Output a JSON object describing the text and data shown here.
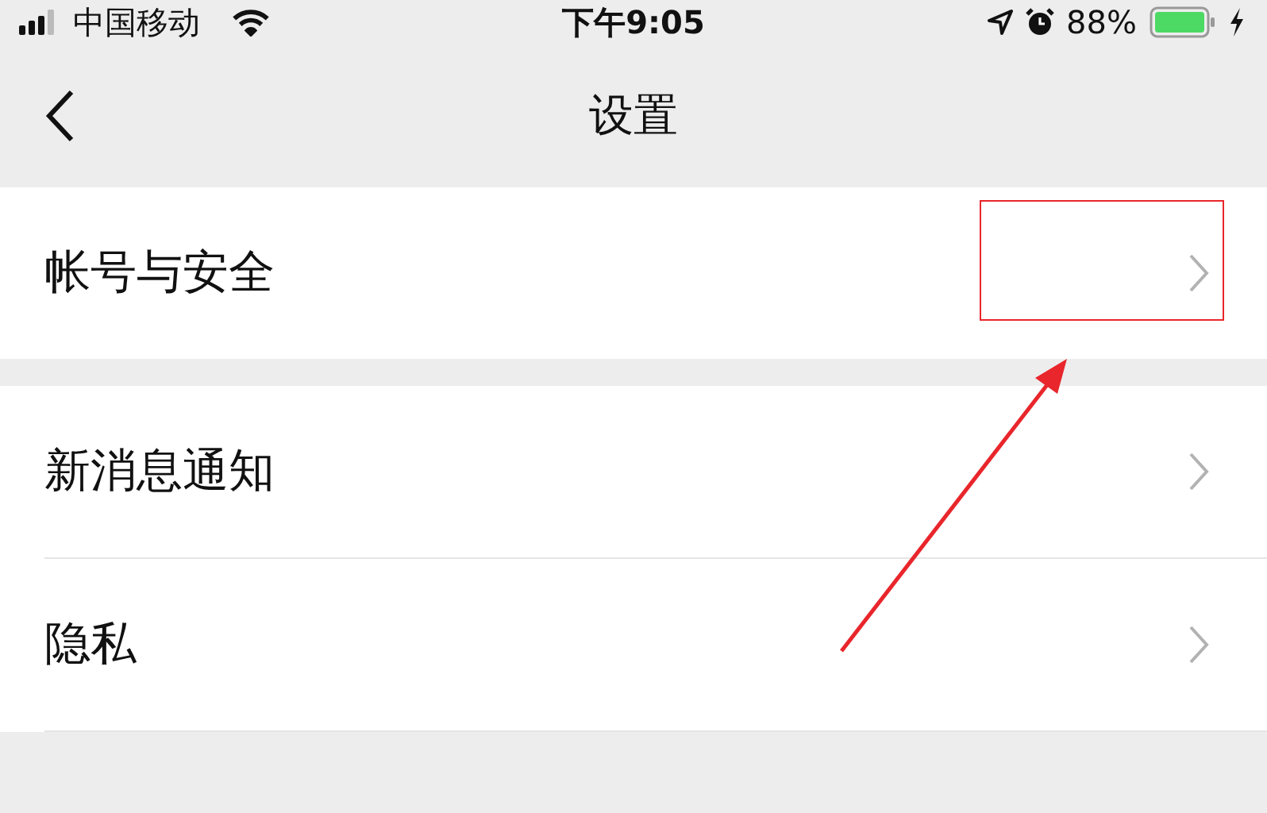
{
  "status_bar": {
    "carrier": "中国移动",
    "time": "下午9:05",
    "battery": "88%"
  },
  "nav": {
    "title": "设置"
  },
  "groups": [
    {
      "items": [
        {
          "label": "帐号与安全",
          "highlighted": true
        }
      ]
    },
    {
      "items": [
        {
          "label": "新消息通知",
          "highlighted": false
        },
        {
          "label": "隐私",
          "highlighted": false
        }
      ]
    }
  ]
}
